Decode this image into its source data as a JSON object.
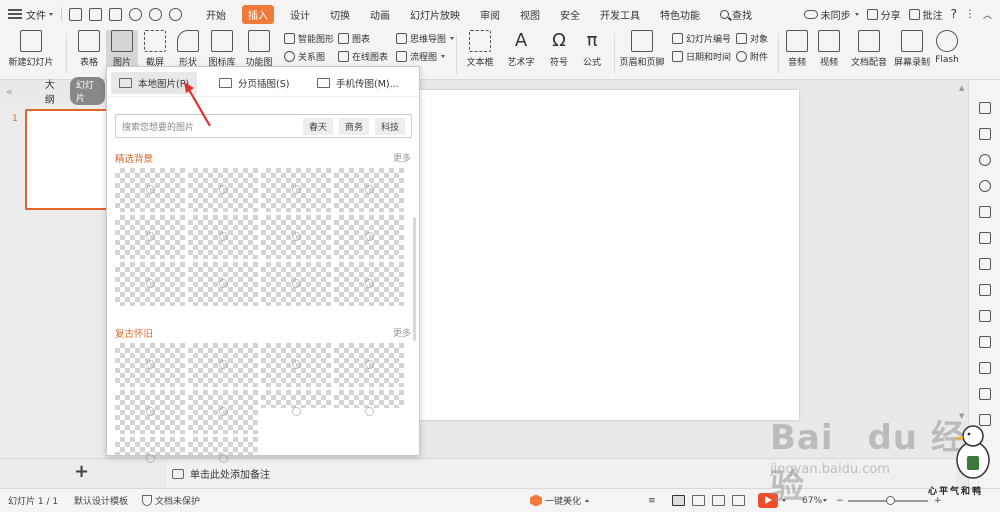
{
  "menubar": {
    "file_label": "文件",
    "tabs": [
      "开始",
      "插入",
      "设计",
      "切换",
      "动画",
      "幻灯片放映",
      "审阅",
      "视图",
      "安全",
      "开发工具",
      "特色功能"
    ],
    "active_tab": "插入",
    "search_label": "查找",
    "right": {
      "sync": "未同步",
      "share": "分享",
      "comment": "批注"
    }
  },
  "ribbon": {
    "new_slide": "新建幻灯片",
    "table": "表格",
    "picture": "图片",
    "screenshot": "截屏",
    "shape": "形状",
    "icon_lib": "图标库",
    "func_chart": "功能图",
    "smart_art": "智能图形",
    "relation": "关系图",
    "chart": "图表",
    "online_chart": "在线图表",
    "mind_map": "思维导图",
    "flowchart": "流程图",
    "textbox": "文本框",
    "wordart": "艺术字",
    "symbol": "符号",
    "formula": "公式",
    "header_footer": "页眉和页脚",
    "slide_number": "幻灯片编号",
    "object": "对象",
    "datetime": "日期和时间",
    "attachment": "附件",
    "audio": "音频",
    "video": "视频",
    "dubbing": "文档配音",
    "screen_record": "屏幕录制",
    "flash": "Flash"
  },
  "outline": {
    "outline_label": "大纲",
    "slides_label": "幻灯片"
  },
  "thumb": {
    "number": "1"
  },
  "dropdown": {
    "tabs": [
      "本地图片(P)",
      "分页插图(S)",
      "手机传图(M)..."
    ],
    "search_placeholder": "搜索您想要的图片",
    "tags": [
      "春天",
      "商务",
      "科技"
    ],
    "section1": "精选背景",
    "section2": "复古怀旧",
    "more": "更多"
  },
  "notes": {
    "placeholder": "单击此处添加备注"
  },
  "status": {
    "slide_info": "幻灯片 1 / 1",
    "template": "默认设计模板",
    "protect": "文档未保护",
    "beautify": "一键美化",
    "zoom": "67%"
  },
  "watermark": {
    "brand": "Bai du 经验",
    "url": "jingyan.baidu.com",
    "signature": "心平气和鸭"
  },
  "colors": {
    "accent": "#f07a3a",
    "selection": "#e0662a",
    "arrow": "#e03030"
  }
}
